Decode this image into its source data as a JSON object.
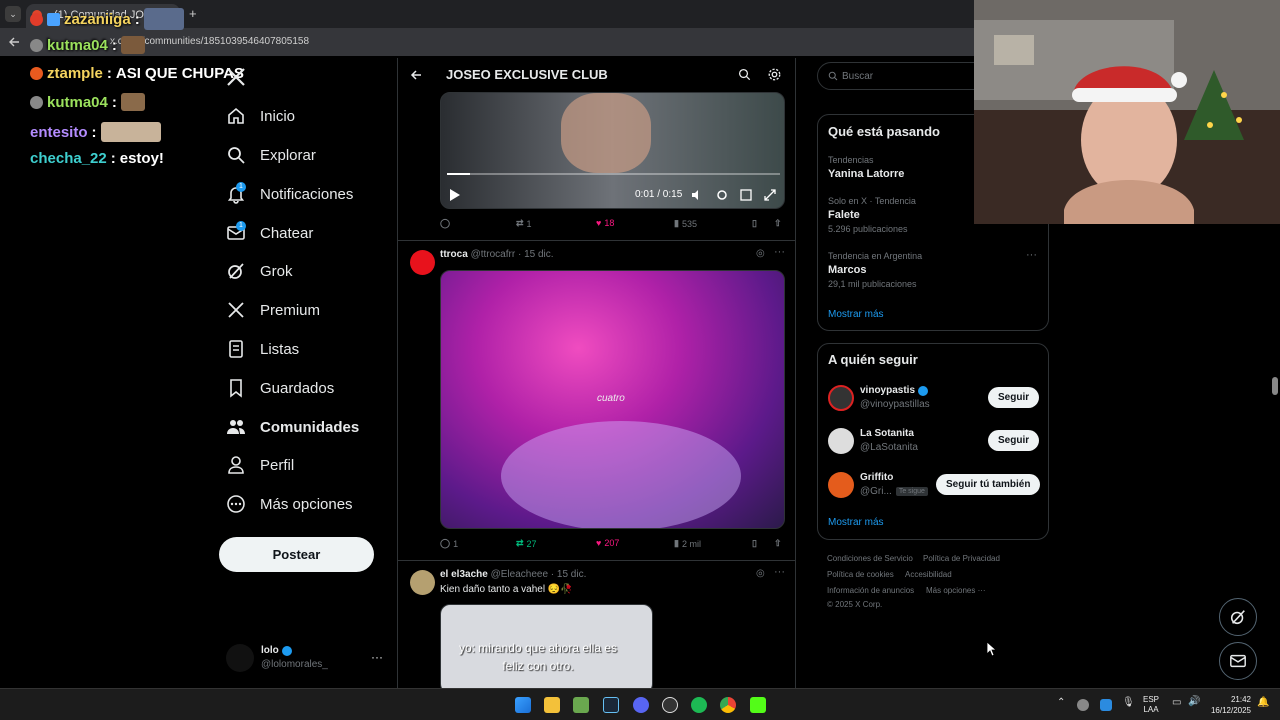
{
  "browser": {
    "tab_title": "(1) Comunidad JOSEO ...",
    "url": "x.com/i/communities/1851039546407805158",
    "new_tab": "+"
  },
  "chat": [
    {
      "user": "zazaniiga",
      "text": "",
      "color": "#f4d35e"
    },
    {
      "user": "kutma04",
      "text": "",
      "color": "#9be15d"
    },
    {
      "user": "ztample",
      "text": "ASI QUE CHUPAS",
      "color": "#f4d35e"
    },
    {
      "user": "kutma04",
      "text": "",
      "color": "#9be15d"
    },
    {
      "user": "entesito",
      "text": "",
      "color": "#b48cff"
    },
    {
      "user": "checha_22",
      "text": "estoy!",
      "color": "#3ecfcf"
    }
  ],
  "nav": {
    "items": [
      {
        "label": "Inicio",
        "icon": "home-icon"
      },
      {
        "label": "Explorar",
        "icon": "search-icon"
      },
      {
        "label": "Notificaciones",
        "icon": "bell-icon",
        "badge": "1"
      },
      {
        "label": "Chatear",
        "icon": "mail-icon",
        "badge": "1"
      },
      {
        "label": "Grok",
        "icon": "grok-icon"
      },
      {
        "label": "Premium",
        "icon": "x-logo-icon"
      },
      {
        "label": "Listas",
        "icon": "list-icon"
      },
      {
        "label": "Guardados",
        "icon": "bookmark-icon"
      },
      {
        "label": "Comunidades",
        "icon": "communities-icon",
        "active": true
      },
      {
        "label": "Perfil",
        "icon": "person-icon"
      },
      {
        "label": "Más opciones",
        "icon": "more-icon"
      }
    ],
    "post_button": "Postear"
  },
  "account": {
    "name": "lolo",
    "handle": "@lolomorales_",
    "more": "···"
  },
  "main": {
    "title": "JOSEO EXCLUSIVE CLUB",
    "video": {
      "time": "0:01 / 0:15"
    },
    "post1_actions": {
      "replies": "",
      "reposts": "1",
      "likes": "18",
      "views": "535"
    },
    "post2": {
      "name": "ttroca",
      "handle": "@ttrocafrr",
      "date": "· 15 dic.",
      "caption_overlay": "cuatro",
      "actions": {
        "replies": "1",
        "reposts": "27",
        "likes": "207",
        "views": "2 mil"
      }
    },
    "post3": {
      "name": "el el3ache",
      "handle": "@Eleacheee",
      "date": "· 15 dic.",
      "text": "Kien daño tanto a vahel 😔🥀",
      "image_text": "yo: mirando que ahora ella es feliz con otro."
    }
  },
  "right": {
    "search_placeholder": "Buscar",
    "trends_title": "Qué está pasando",
    "trends": [
      {
        "meta": "Tendencias",
        "name": "Yanina Latorre",
        "count": ""
      },
      {
        "meta": "Solo en X · Tendencia",
        "name": "Falete",
        "count": "5.296 publicaciones"
      },
      {
        "meta": "Tendencia en Argentina",
        "name": "Marcos",
        "count": "29,1 mil publicaciones"
      }
    ],
    "trends_more": "Mostrar más",
    "follow_title": "A quién seguir",
    "follow": [
      {
        "name": "vinoypastis",
        "handle": "@vinoypastillas",
        "button": "Seguir",
        "verified": true
      },
      {
        "name": "La Sotanita",
        "handle": "@LaSotanita",
        "button": "Seguir",
        "verified": false
      },
      {
        "name": "Griffito",
        "handle": "@Gri...",
        "button": "Seguir tú también",
        "follows_you": "Te sigue",
        "verified": false
      }
    ],
    "follow_more": "Mostrar más",
    "footer": [
      "Condiciones de Servicio",
      "Política de Privacidad",
      "Política de cookies",
      "Accesibilidad",
      "Información de anuncios",
      "Más opciones ···",
      "© 2025 X Corp."
    ]
  },
  "taskbar": {
    "lang": "ESP",
    "layout": "LAA",
    "time": "21:42",
    "date": "16/12/2025"
  }
}
